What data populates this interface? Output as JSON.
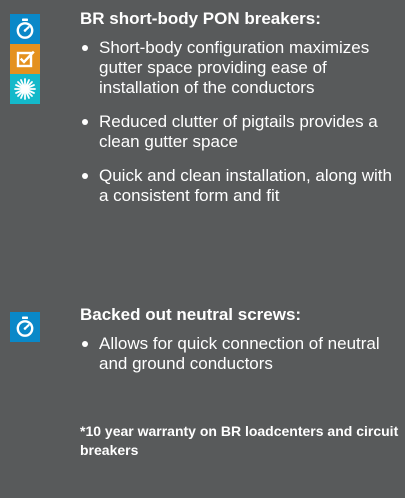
{
  "sections": [
    {
      "heading": "BR short-body PON breakers:",
      "bullets": [
        "Short-body configuration maximizes gutter space providing ease of installation of the conductors",
        "Reduced clutter of pigtails provides a clean gutter space",
        "Quick and clean installation, along with a consistent form and fit"
      ],
      "icons": [
        "stopwatch-icon",
        "checkbox-icon",
        "starburst-icon"
      ]
    },
    {
      "heading": "Backed out neutral screws:",
      "bullets": [
        "Allows for quick connection of neutral and ground conductors"
      ],
      "icons": [
        "stopwatch-icon"
      ]
    }
  ],
  "footnote": "*10 year warranty on BR loadcenters and circuit breakers",
  "colors": {
    "background": "#585a5b",
    "text": "#ffffff",
    "stopwatch_icon_bg": "#0a88c8",
    "checkbox_icon_bg": "#e4911f",
    "starburst_icon_bg": "#14b9ca"
  }
}
